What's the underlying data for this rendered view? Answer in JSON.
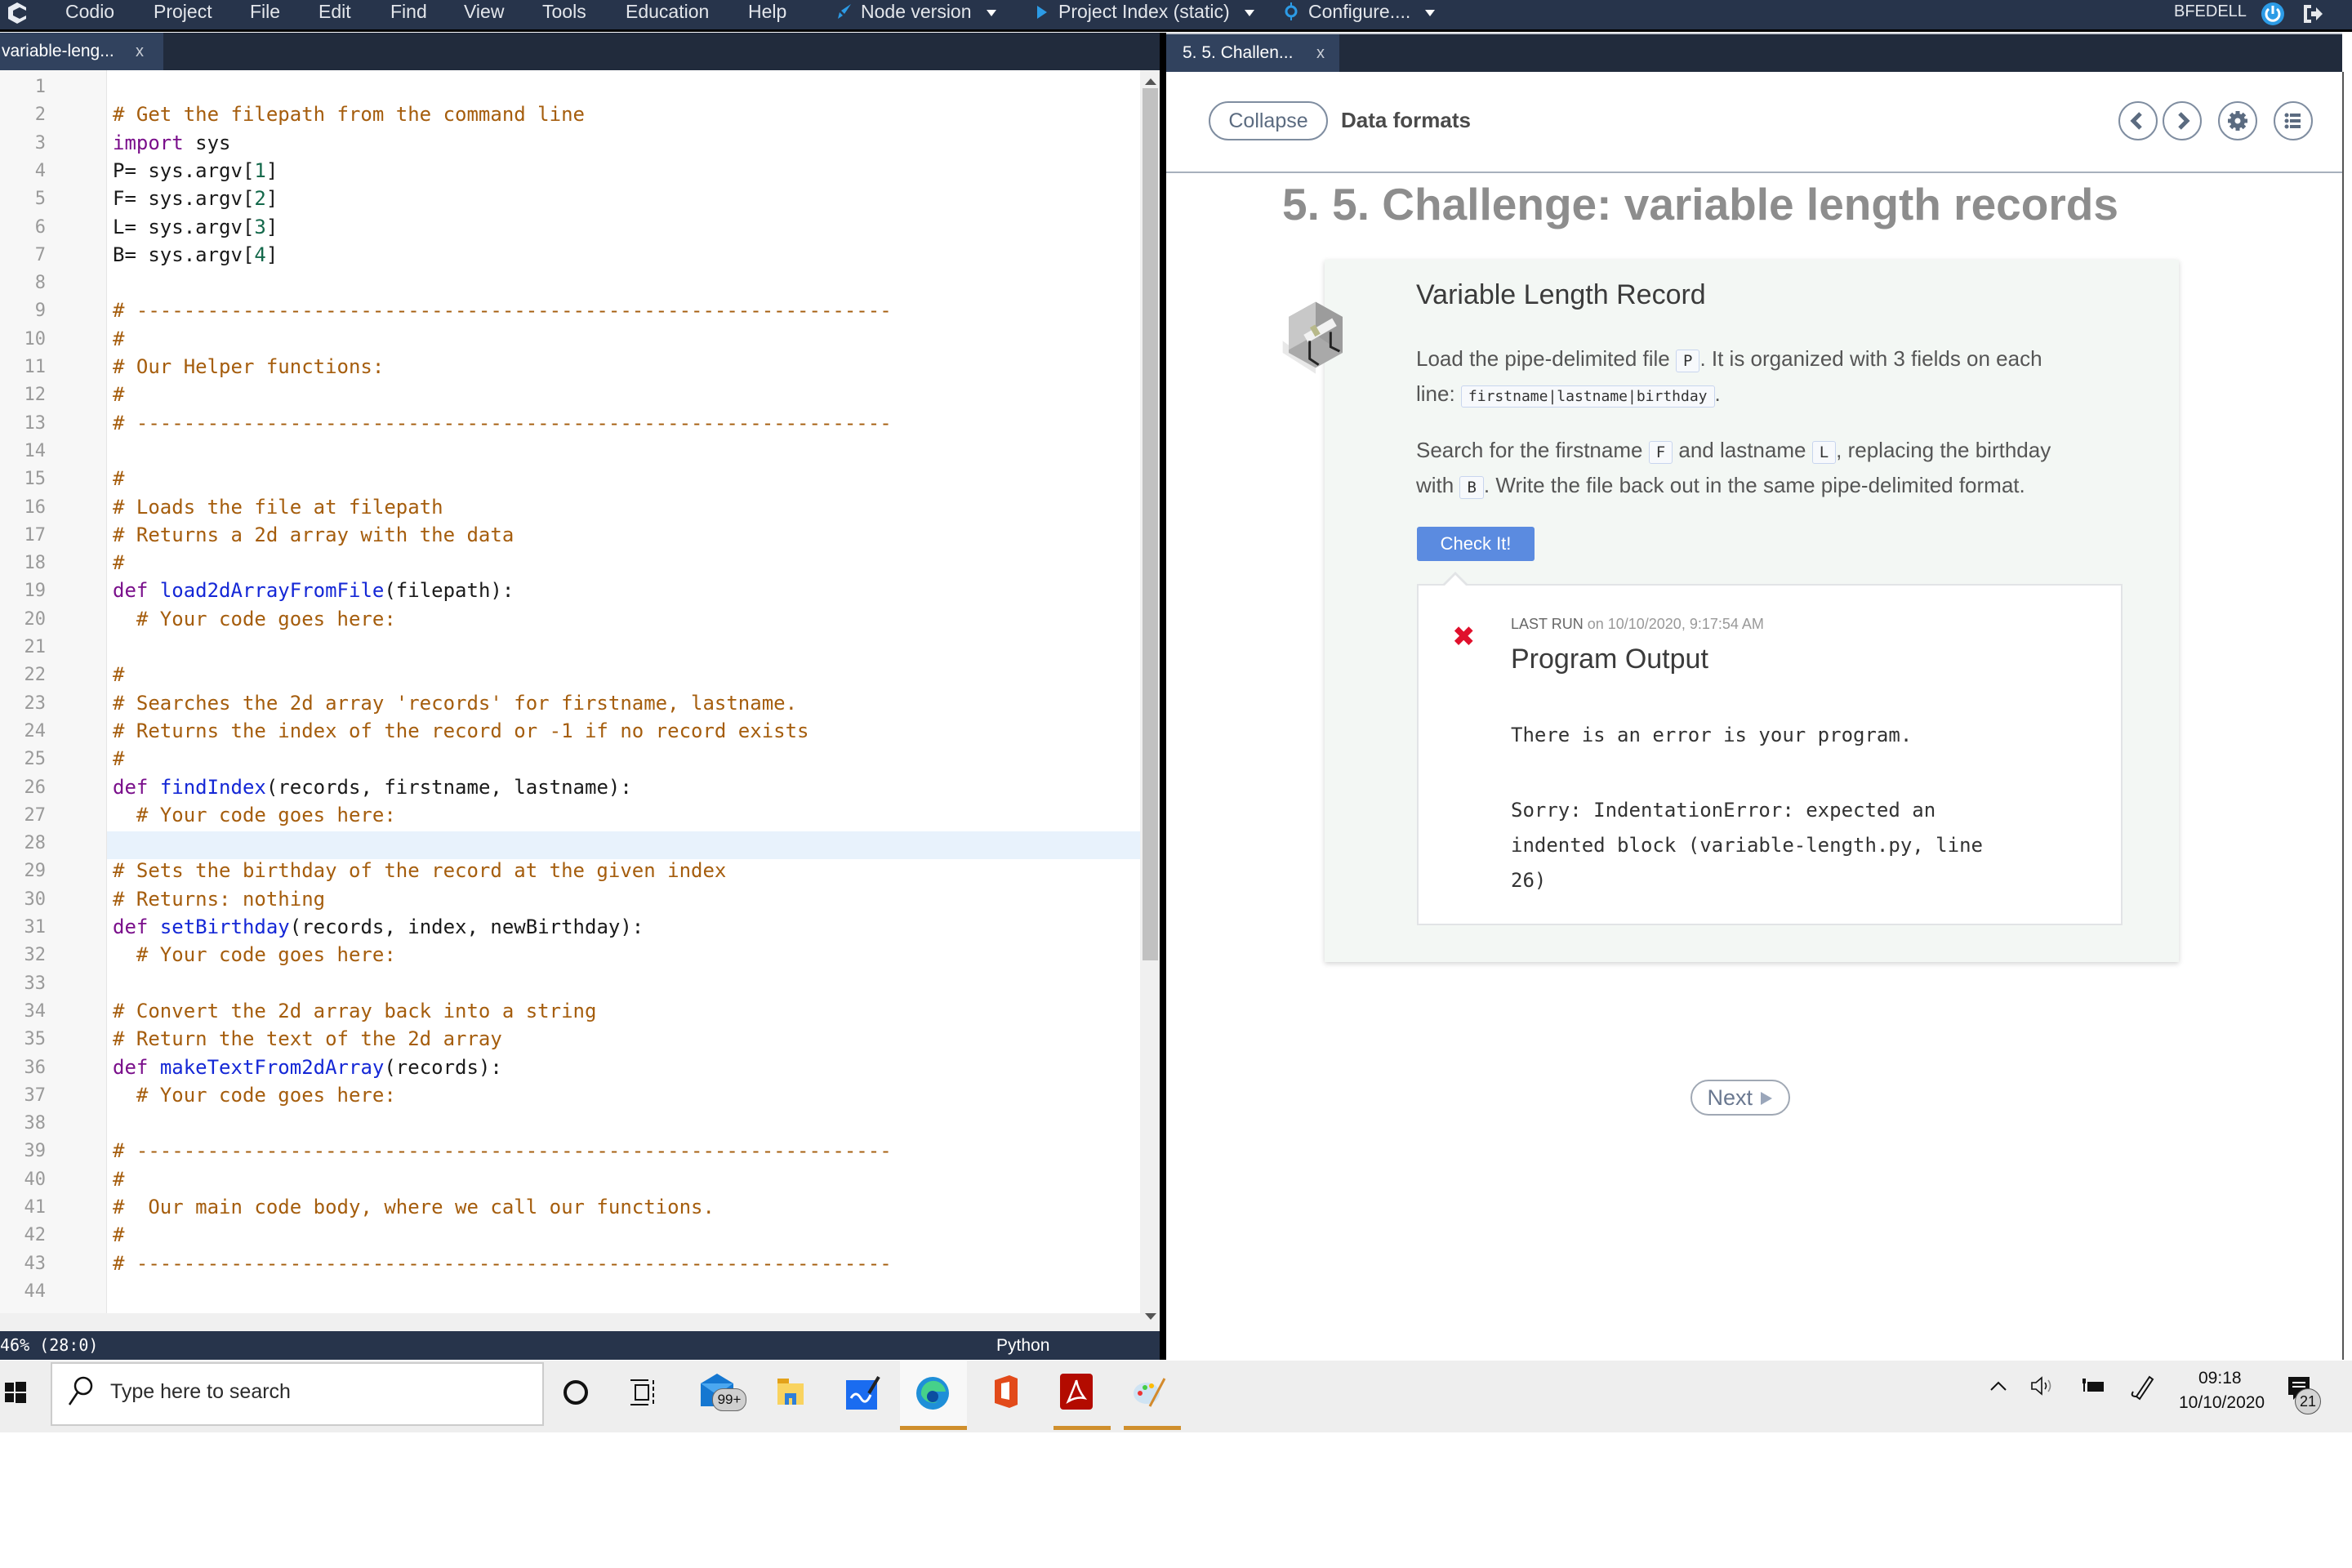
{
  "menubar": {
    "app_logo": "codio-logo-icon",
    "items": [
      "Codio",
      "Project",
      "File",
      "Edit",
      "Find",
      "View",
      "Tools",
      "Education",
      "Help"
    ],
    "run_menus": [
      {
        "icon": "rocket-icon",
        "label": "Node version"
      },
      {
        "icon": "play-icon",
        "label": "Project Index (static)"
      },
      {
        "icon": "target-icon",
        "label": "Configure...."
      }
    ],
    "username": "BFEDELL",
    "power_icon": "power-icon",
    "logout_icon": "logout-icon",
    "accent_color": "#2c9be6"
  },
  "left_tab": {
    "label": "variable-leng...",
    "close": "x"
  },
  "right_tab": {
    "label": "5. 5. Challen...",
    "close": "x"
  },
  "editor": {
    "active_line": 28,
    "lines": [
      [],
      [
        [
          "cm",
          "# Get the filepath from the command line"
        ]
      ],
      [
        [
          "kw",
          "import"
        ],
        [
          "",
          " sys"
        ]
      ],
      [
        [
          "",
          "P= sys.argv["
        ],
        [
          "num",
          "1"
        ],
        [
          "",
          "]"
        ]
      ],
      [
        [
          "",
          "F= sys.argv["
        ],
        [
          "num",
          "2"
        ],
        [
          "",
          "]"
        ]
      ],
      [
        [
          "",
          "L= sys.argv["
        ],
        [
          "num",
          "3"
        ],
        [
          "",
          "]"
        ]
      ],
      [
        [
          "",
          "B= sys.argv["
        ],
        [
          "num",
          "4"
        ],
        [
          "",
          "]"
        ]
      ],
      [],
      [
        [
          "cm",
          "# ----------------------------------------------------------------"
        ]
      ],
      [
        [
          "cm",
          "#"
        ]
      ],
      [
        [
          "cm",
          "# Our Helper functions:"
        ]
      ],
      [
        [
          "cm",
          "#"
        ]
      ],
      [
        [
          "cm",
          "# ----------------------------------------------------------------"
        ]
      ],
      [],
      [
        [
          "cm",
          "#"
        ]
      ],
      [
        [
          "cm",
          "# Loads the file at filepath"
        ]
      ],
      [
        [
          "cm",
          "# Returns a 2d array with the data"
        ]
      ],
      [
        [
          "cm",
          "#"
        ]
      ],
      [
        [
          "kw",
          "def"
        ],
        [
          "",
          " "
        ],
        [
          "fn",
          "load2dArrayFromFile"
        ],
        [
          "",
          "(filepath):"
        ]
      ],
      [
        [
          "cm",
          "  # Your code goes here:"
        ]
      ],
      [],
      [
        [
          "cm",
          "#"
        ]
      ],
      [
        [
          "cm",
          "# Searches the 2d array 'records' for firstname, lastname."
        ]
      ],
      [
        [
          "cm",
          "# Returns the index of the record or -1 if no record exists"
        ]
      ],
      [
        [
          "cm",
          "#"
        ]
      ],
      [
        [
          "kw",
          "def"
        ],
        [
          "",
          " "
        ],
        [
          "fn",
          "findIndex"
        ],
        [
          "",
          "(records, firstname, lastname):"
        ]
      ],
      [
        [
          "cm",
          "  # Your code goes here:"
        ]
      ],
      [],
      [
        [
          "cm",
          "# Sets the birthday of the record at the given index"
        ]
      ],
      [
        [
          "cm",
          "# Returns: nothing"
        ]
      ],
      [
        [
          "kw",
          "def"
        ],
        [
          "",
          " "
        ],
        [
          "fn",
          "setBirthday"
        ],
        [
          "",
          "(records, index, newBirthday):"
        ]
      ],
      [
        [
          "cm",
          "  # Your code goes here:"
        ]
      ],
      [],
      [
        [
          "cm",
          "# Convert the 2d array back into a string"
        ]
      ],
      [
        [
          "cm",
          "# Return the text of the 2d array"
        ]
      ],
      [
        [
          "kw",
          "def"
        ],
        [
          "",
          " "
        ],
        [
          "fn",
          "makeTextFrom2dArray"
        ],
        [
          "",
          "(records):"
        ]
      ],
      [
        [
          "cm",
          "  # Your code goes here:"
        ]
      ],
      [],
      [
        [
          "cm",
          "# ----------------------------------------------------------------"
        ]
      ],
      [
        [
          "cm",
          "#"
        ]
      ],
      [
        [
          "cm",
          "#  Our main code body, where we call our functions."
        ]
      ],
      [
        [
          "cm",
          "#"
        ]
      ],
      [
        [
          "cm",
          "# ----------------------------------------------------------------"
        ]
      ],
      []
    ]
  },
  "statusbar": {
    "position": "46% (28:0)",
    "language": "Python"
  },
  "guide": {
    "collapse_label": "Collapse",
    "section_title": "Data formats",
    "nav_icons": [
      "chevron-left-icon",
      "chevron-right-icon",
      "gear-icon",
      "list-icon"
    ],
    "page_title": "5. 5. Challenge: variable length records",
    "card": {
      "title": "Variable Length Record",
      "p1_a": "Load the pipe-delimited file ",
      "p1_code1": "P",
      "p1_b": ". It is organized with 3 fields on each",
      "p1_c": "line: ",
      "p1_code2": "firstname|lastname|birthday",
      "p1_d": ".",
      "p2_a": "Search for the firstname ",
      "p2_code1": "F",
      "p2_b": " and lastname ",
      "p2_code2": "L",
      "p2_c": ", replacing the birthday",
      "p2_d": "with ",
      "p2_code3": "B",
      "p2_e": ". Write the file back out in the same pipe-delimited format.",
      "check_label": "Check It!",
      "check_color": "#5b8be0"
    },
    "output": {
      "status": "error",
      "status_icon": "x-mark-icon",
      "lastrun_label": "LAST RUN",
      "lastrun_rest": " on 10/10/2020, 9:17:54 AM",
      "title": "Program Output",
      "line1": "There is an error is your program.",
      "line2": "Sorry: IndentationError: expected an",
      "line3": "indented block (variable-length.py, line",
      "line4": "26)",
      "error_color": "#e0102c"
    },
    "next_label": "Next"
  },
  "taskbar": {
    "search_placeholder": "Type here to search",
    "mail_badge": "99+",
    "apps": [
      "cortana-icon",
      "task-view-icon",
      "mail-icon",
      "file-explorer-icon",
      "whiteboard-icon",
      "edge-icon",
      "office-icon",
      "acrobat-icon",
      "paint-icon"
    ],
    "tray": [
      "chevron-up-icon",
      "volume-icon",
      "battery-icon",
      "pen-icon"
    ],
    "time": "09:18",
    "date": "10/10/2020",
    "notifications_count": "21"
  }
}
